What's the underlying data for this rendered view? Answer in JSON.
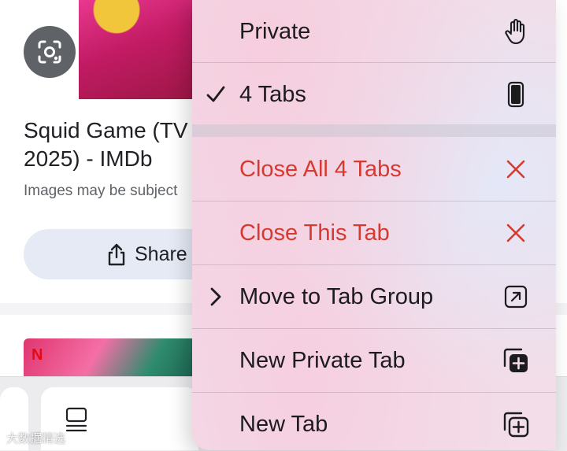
{
  "background": {
    "result_title_line1": "Squid Game (TV",
    "result_title_line2": "2025) - IMDb",
    "result_note": "Images may be subject",
    "share_label": "Share",
    "thumb_logo": "N",
    "watermark": "大数据精选"
  },
  "menu": {
    "items": [
      {
        "label": "Private",
        "lead": "",
        "trail_icon": "hand-icon",
        "destructive": false
      },
      {
        "label": "4 Tabs",
        "lead": "checkmark",
        "trail_icon": "phone-icon",
        "destructive": false
      },
      {
        "label": "Close All 4 Tabs",
        "lead": "",
        "trail_icon": "close-icon",
        "destructive": true
      },
      {
        "label": "Close This Tab",
        "lead": "",
        "trail_icon": "close-icon",
        "destructive": true
      },
      {
        "label": "Move to Tab Group",
        "lead": "chevron",
        "trail_icon": "arrow-up-right-square-icon",
        "destructive": false
      },
      {
        "label": "New Private Tab",
        "lead": "",
        "trail_icon": "plus-square-on-square-filled-icon",
        "destructive": false
      },
      {
        "label": "New Tab",
        "lead": "",
        "trail_icon": "plus-square-on-square-icon",
        "destructive": false
      }
    ]
  },
  "colors": {
    "destructive": "#d63a2f",
    "text": "#1c1c1e",
    "lens_button": "#5f6368",
    "share_button": "#e6eaf5"
  }
}
